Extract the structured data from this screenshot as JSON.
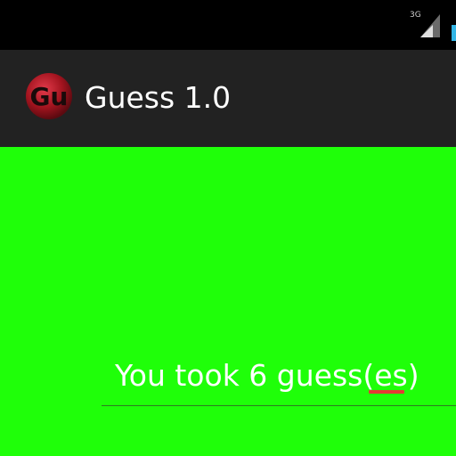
{
  "status_bar": {
    "network_label": "3G",
    "icons": [
      "signal-icon",
      "battery-icon"
    ],
    "accent_color": "#33b5e5"
  },
  "action_bar": {
    "icon_letters": "Gu",
    "title": "Guess 1.0",
    "background_color": "#222222"
  },
  "content": {
    "background_color": "#1fff09",
    "result_field": {
      "value": "You took 6 guess(es)",
      "spellcheck_flag_color": "#e53935"
    }
  }
}
